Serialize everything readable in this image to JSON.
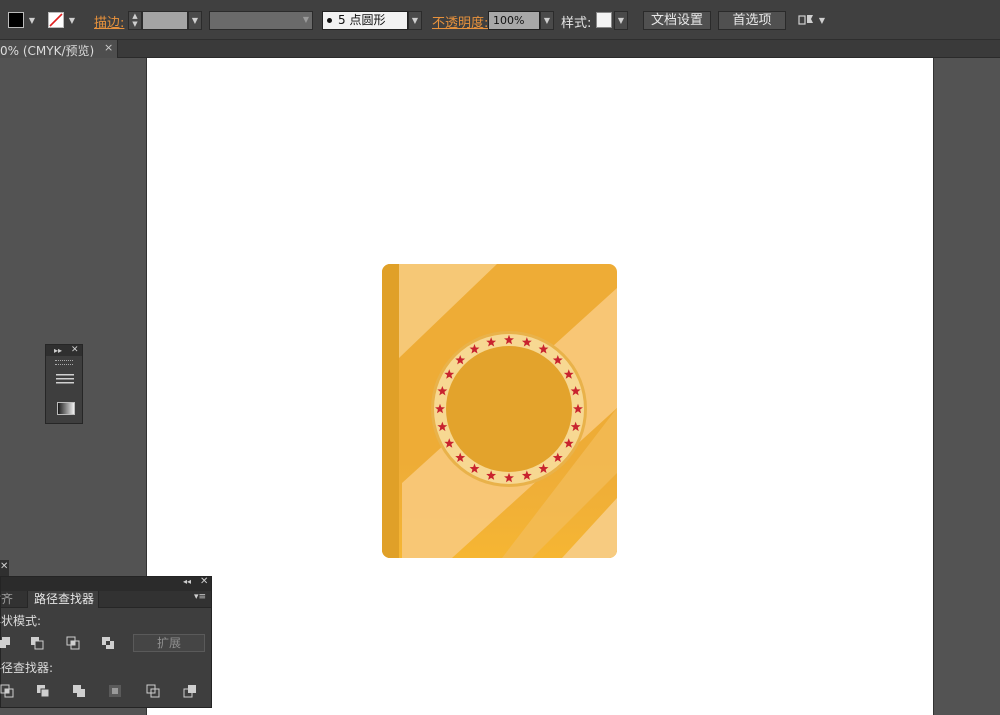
{
  "toolbar": {
    "stroke_label": "描边:",
    "brush_value": "5 点圆形",
    "opacity_label": "不透明度:",
    "opacity_value": "100%",
    "style_label": "样式:",
    "doc_setup_label": "文档设置",
    "preferences_label": "首选项"
  },
  "document_tab": {
    "label": "0% (CMYK/预览)",
    "close": "×"
  },
  "pathfinder_panel": {
    "tab_align": "对齐",
    "tab_pathfinder": "路径查找器",
    "shape_modes_label": "形状模式:",
    "pathfinders_label": "路径查找器:",
    "expand_label": "扩展"
  },
  "artwork": {
    "book_color": "#eeac36",
    "spine_color": "#e0a028",
    "badge_ring_color": "#f7d892",
    "badge_center_color": "#e3a32c",
    "star_color": "#c8232e",
    "star_count": 24
  },
  "colors": {
    "ui_bg": "#535353",
    "bar_bg": "#404040",
    "accent_label": "#e8923c"
  }
}
